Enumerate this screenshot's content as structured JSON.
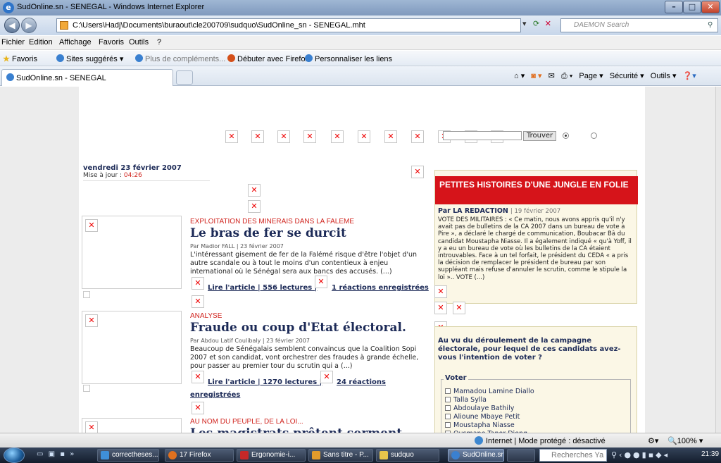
{
  "window": {
    "title": "SudOnline.sn - SENEGAL - Windows Internet Explorer",
    "address": "C:\\Users\\Hadj\\Documents\\buraout\\cle200709\\sudquo\\SudOnline_sn - SENEGAL.mht",
    "search_placeholder": "DAEMON Search"
  },
  "menu": [
    "Fichier",
    "Edition",
    "Affichage",
    "Favoris",
    "Outils",
    "?"
  ],
  "favorites_bar": {
    "favoris": "Favoris",
    "sites": "Sites suggérés ▾",
    "plus": "Plus de compléments... ▾",
    "firefox": "Débuter avec Firefox",
    "personnaliser": "Personnaliser les liens"
  },
  "tab": {
    "label": "SudOnline.sn - SENEGAL"
  },
  "command_bar": {
    "page": "Page ▾",
    "securite": "Sécurité ▾",
    "outils": "Outils ▾"
  },
  "page": {
    "date": "vendredi 23 février 2007",
    "update_label": "Mise à jour :",
    "update_time": "04:26",
    "search_button": "Trouver",
    "story": {
      "heading": "PETITES HISTOIRES D'UNE JUNGLE EN FOLIE",
      "author": "Par LA REDACTION",
      "date": "| 19 février 2007",
      "text": "VOTE DES MILITAIRES : « Ce matin, nous avons appris qu'il n'y avait pas de bulletins de la CA 2007 dans un bureau de vote à Pire », a déclaré le chargé de communication, Boubacar Bâ du candidat Moustapha Niasse. Il a également indiqué « qu'à Yoff, il y a eu un bureau de vote où les bulletins de la CA étaient introuvables. Face à un tel forfait, le président du CEDA « a pris la décision de remplacer le président de bureau par son suppléant mais refuse d'annuler le scrutin, comme le stipule la loi ».. VOTE (...)"
    },
    "articles": [
      {
        "rubrique": "EXPLOITATION DES MINERAIS DANS LA FALEME",
        "title": "Le bras de fer se durcit",
        "byline": "Par Madior FALL | 23 février 2007",
        "intro": "L'intéressant gisement de fer de la Falémé risque d'être l'objet d'un autre scandale ou à tout le moins d'un contentieux à enjeu international où le Sénégal sera aux bancs des accusés. (...)",
        "link1": "Lire l'article | 556 lectures |",
        "link2": "1 réactions enregistrées"
      },
      {
        "rubrique": "ANALYSE",
        "title": "Fraude ou coup d'Etat électoral.",
        "byline": "Par Abdou Latif Coulibaly | 23 février 2007",
        "intro": "Beaucoup de Sénégalais semblent convaincus que la Coalition Sopi 2007 et son candidat, vont orchestrer des fraudes à grande échelle, pour passer au premier tour du scrutin qui a (...)",
        "link1": "Lire l'article | 1270 lectures |",
        "link2": "24 réactions",
        "link3": "enregistrées"
      },
      {
        "rubrique": "AU NOM DU PEUPLE, DE LA LOI...",
        "title": "Les magistrats prêtent serment"
      }
    ],
    "poll": {
      "question": "Au vu du déroulement de la campagne électorale, pour lequel de ces candidats avez-vous l'intention de voter ?",
      "legend": "Voter",
      "options": [
        "Mamadou Lamine Diallo",
        "Talla Sylla",
        "Abdoulaye Bathily",
        "Alioune Mbaye Petit",
        "Moustapha Niasse",
        "Ousmane Tanor Dieng"
      ]
    }
  },
  "status": {
    "zone": "Internet | Mode protégé : désactivé",
    "zoom": "100%"
  },
  "taskbar": {
    "items": [
      "correctheses...",
      "17 Firefox",
      "Ergonomie-i...",
      "Sans titre - P...",
      "sudquo",
      "SudOnline.sn..."
    ],
    "search": "Recherches Ya",
    "clock": "21:39"
  }
}
